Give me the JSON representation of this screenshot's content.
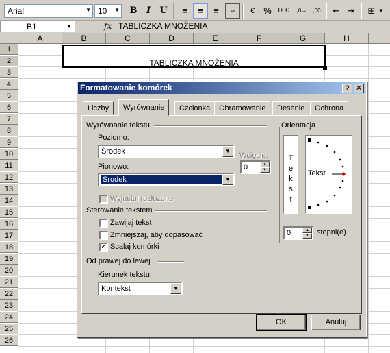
{
  "toolbar": {
    "font_name": "Arial",
    "font_size": "10",
    "bold": "B",
    "italic": "I",
    "underline": "U",
    "percent": "%",
    "thousands": "000",
    "dec_increase": ",0→",
    "dec_decrease": ",00"
  },
  "formula_bar": {
    "name_box": "B1",
    "fx": "fx",
    "formula": "TABLICZKA MNOŻENIA"
  },
  "grid": {
    "columns": [
      "A",
      "B",
      "C",
      "D",
      "E",
      "F",
      "G",
      "H"
    ],
    "rows": [
      "1",
      "2",
      "3",
      "4",
      "5",
      "6",
      "7",
      "8",
      "9",
      "10",
      "11",
      "12",
      "13",
      "14",
      "15",
      "16",
      "17",
      "18",
      "19",
      "20",
      "21",
      "22",
      "23",
      "24",
      "25",
      "26"
    ],
    "merged_cell_text": "TABLICZKA MNOŻENIA"
  },
  "dialog": {
    "title": "Formatowanie komórek",
    "help_btn": "?",
    "close_btn": "✕",
    "tabs": [
      "Liczby",
      "Wyrównanie",
      "Czcionka",
      "Obramowanie",
      "Desenie",
      "Ochrona"
    ],
    "text_align_group": "Wyrównanie tekstu",
    "horizontal_label": "Poziomo:",
    "horizontal_value": "Środek",
    "indent_label": "Wcięcie:",
    "indent_value": "0",
    "vertical_label": "Pionowo:",
    "vertical_value": "Środek",
    "justify_distributed": "Wyjustuj rozłożone",
    "text_control_group": "Sterowanie tekstem",
    "wrap_text": "Zawijaj tekst",
    "shrink_to_fit": "Zmniejszaj, aby dopasować",
    "merge_cells": "Scalaj komórki",
    "merge_checked": "✓",
    "rtl_group": "Od prawej do lewej",
    "direction_label": "Kierunek tekstu:",
    "direction_value": "Kontekst",
    "orientation_group": "Orientacja",
    "vertical_text": [
      "T",
      "e",
      "k",
      "s",
      "t"
    ],
    "dial_text": "Tekst",
    "degrees_value": "0",
    "degrees_label": "stopni(e)",
    "ok": "OK",
    "cancel": "Anuluj"
  }
}
